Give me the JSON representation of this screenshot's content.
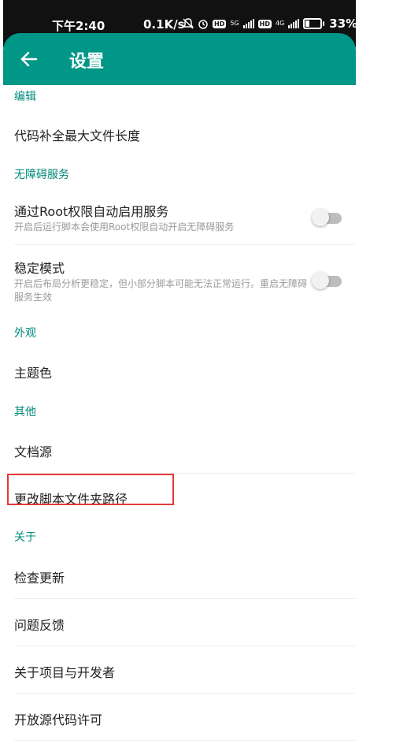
{
  "status_bar": {
    "time": "下午2:40",
    "net_speed": "0.1K/s",
    "net1": "5G",
    "net2": "4G",
    "battery_pct": "33%",
    "battery_level": 0.33,
    "icons": [
      "mute-icon",
      "alarm-icon",
      "hd-icon",
      "signal-icon",
      "hd-icon",
      "signal-icon",
      "battery-icon"
    ]
  },
  "app_bar": {
    "title": "设置",
    "back_icon": "arrow-left-icon",
    "background": "#009688"
  },
  "sections": {
    "editing": "编辑",
    "accessibility": "无障碍服务",
    "appearance": "外观",
    "other": "其他",
    "about": "关于"
  },
  "items": {
    "completion_max_length": {
      "title": "代码补全最大文件长度"
    },
    "root_auto_enable": {
      "title": "通过Root权限自动启用服务",
      "subtitle": "开启后运行脚本会使用Root权限自动开启无障碍服务",
      "enabled": false
    },
    "stable_mode": {
      "title": "稳定模式",
      "subtitle": "开启后布局分析更稳定，但小部分脚本可能无法正常运行。重启无障碍服务生效",
      "enabled": false
    },
    "theme_color": {
      "title": "主题色"
    },
    "docs_source": {
      "title": "文档源"
    },
    "script_folder": {
      "title": "更改脚本文件夹路径"
    },
    "check_update": {
      "title": "检查更新"
    },
    "feedback": {
      "title": "问题反馈"
    },
    "about_project": {
      "title": "关于项目与开发者"
    },
    "open_source": {
      "title": "开放源代码许可"
    }
  },
  "colors": {
    "accent": "#00897b",
    "highlight": "#e53935"
  }
}
